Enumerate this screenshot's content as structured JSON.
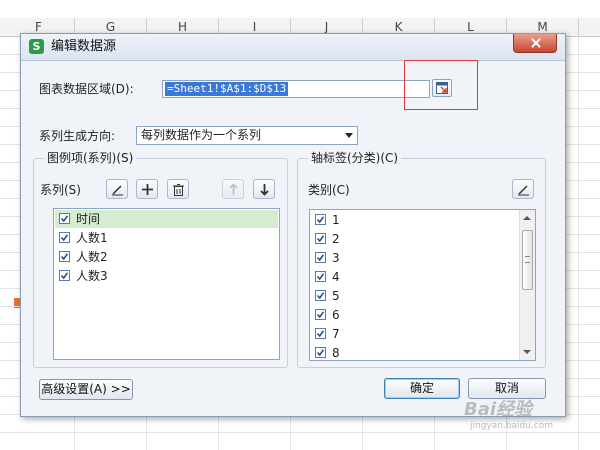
{
  "spreadsheet": {
    "columns": [
      "F",
      "G",
      "H",
      "I",
      "J",
      "K",
      "L",
      "M"
    ]
  },
  "dialog": {
    "title": "编辑数据源",
    "app_icon": "S",
    "range_label": "图表数据区域(D):",
    "range_value": "=Sheet1!$A$1:$D$13",
    "direction_label": "系列生成方向:",
    "direction_value": "每列数据作为一个系列",
    "legend_group": {
      "title": "图例项(系列)(S)",
      "series_label": "系列(S)",
      "items": [
        {
          "label": "时间",
          "checked": true,
          "selected": true
        },
        {
          "label": "人数1",
          "checked": true,
          "selected": false
        },
        {
          "label": "人数2",
          "checked": true,
          "selected": false
        },
        {
          "label": "人数3",
          "checked": true,
          "selected": false
        }
      ]
    },
    "axis_group": {
      "title": "轴标签(分类)(C)",
      "category_label": "类别(C)",
      "items": [
        "1",
        "2",
        "3",
        "4",
        "5",
        "6",
        "7",
        "8"
      ]
    },
    "advanced_button": "高级设置(A) >>",
    "ok_button": "确定",
    "cancel_button": "取消"
  },
  "watermark": {
    "brand": "Bai经验",
    "url": "jingyan.baidu.com"
  },
  "colors": {
    "selection_blue": "#3b78d8",
    "selected_row": "#d5ecd0",
    "highlight_red": "#e0383e",
    "close_red": "#c9462f"
  }
}
